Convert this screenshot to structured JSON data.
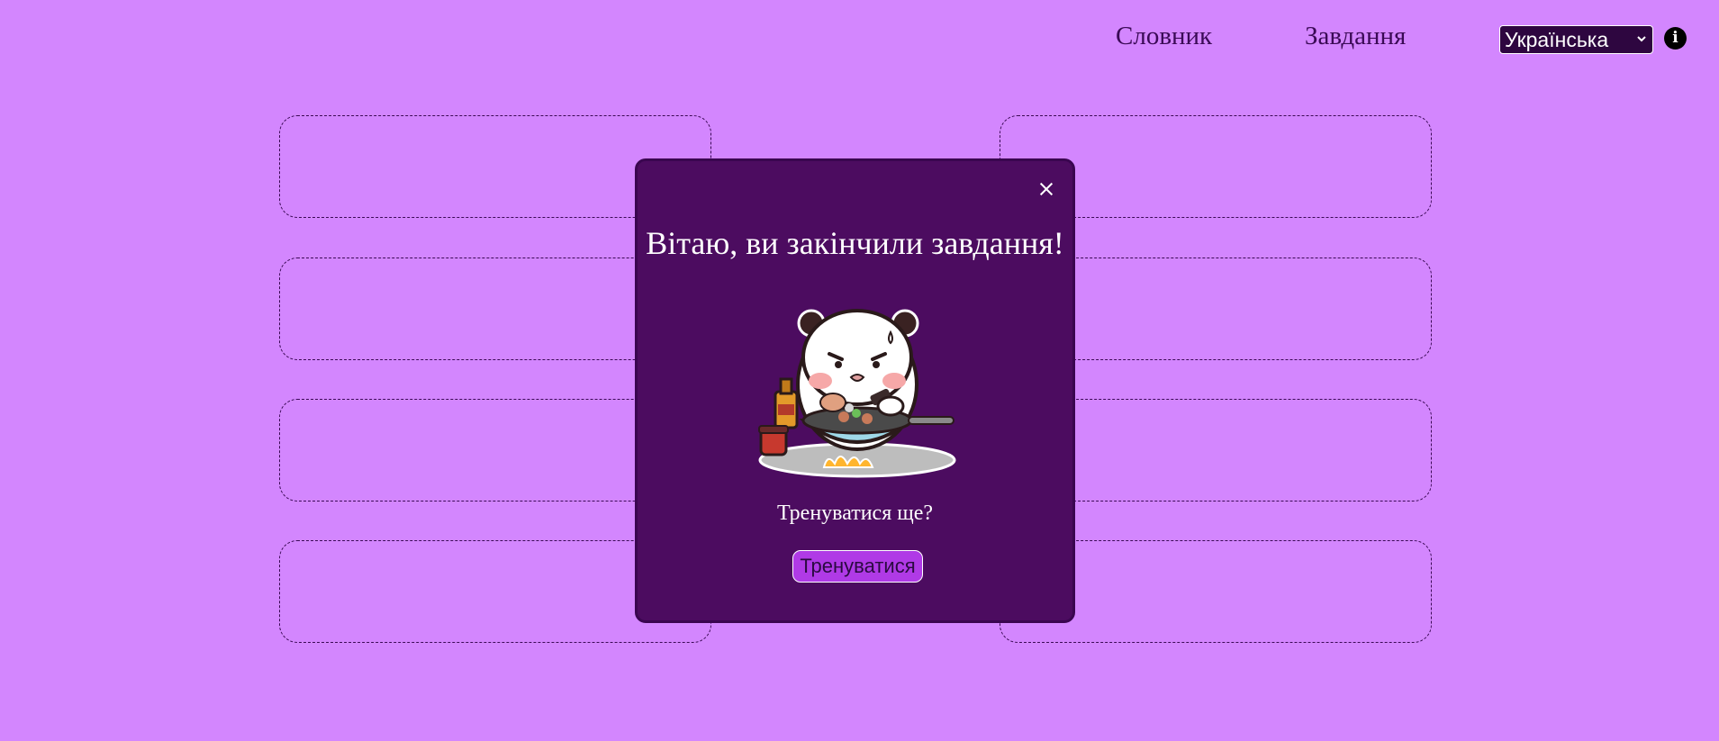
{
  "nav": {
    "dictionary_label": "Словник",
    "tasks_label": "Завдання",
    "language_selected": "Українська",
    "info_icon_glyph": "i"
  },
  "modal": {
    "title": "Вітаю, ви закінчили завдання!",
    "question": "Тренуватися ще?",
    "train_button_label": "Тренуватися",
    "close_glyph": "×"
  },
  "colors": {
    "page_background": "#d386fe",
    "modal_background": "#4c0c60",
    "button_background": "#b03ae6",
    "select_background": "#2e0640"
  },
  "icons": {
    "close": "close-icon",
    "info": "info-icon",
    "dropdown": "chevron-down-icon",
    "sticker": "panda-cooking-sticker"
  }
}
